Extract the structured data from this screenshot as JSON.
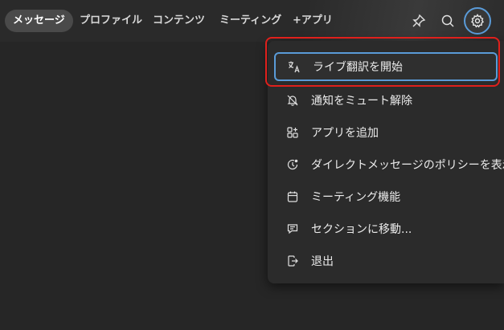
{
  "tabs": [
    {
      "label": "メッセージ",
      "active": true
    },
    {
      "label": "プロファイル"
    },
    {
      "label": "コンテンツ"
    },
    {
      "label": "ミーティング"
    },
    {
      "label": "+アプリ"
    }
  ],
  "header_icons": [
    "pin-icon",
    "search-icon",
    "gear-icon"
  ],
  "menu": {
    "items": [
      {
        "label": "ライブ翻訳を開始",
        "icon": "translate-icon"
      },
      {
        "label": "通知をミュート解除",
        "icon": "bell-off-icon"
      },
      {
        "label": "アプリを追加",
        "icon": "add-app-icon"
      },
      {
        "label": "ダイレクトメッセージのポリシーを表示",
        "icon": "policy-icon"
      },
      {
        "label": "ミーティング機能",
        "icon": "calendar-icon"
      },
      {
        "label": "セクションに移動...",
        "icon": "section-icon"
      },
      {
        "label": "退出",
        "icon": "exit-icon"
      }
    ]
  },
  "colors": {
    "background": "#262626",
    "menu_bg": "#2b2b2b",
    "focus_ring": "#5a9bd8",
    "highlight_red": "#e0201c"
  }
}
